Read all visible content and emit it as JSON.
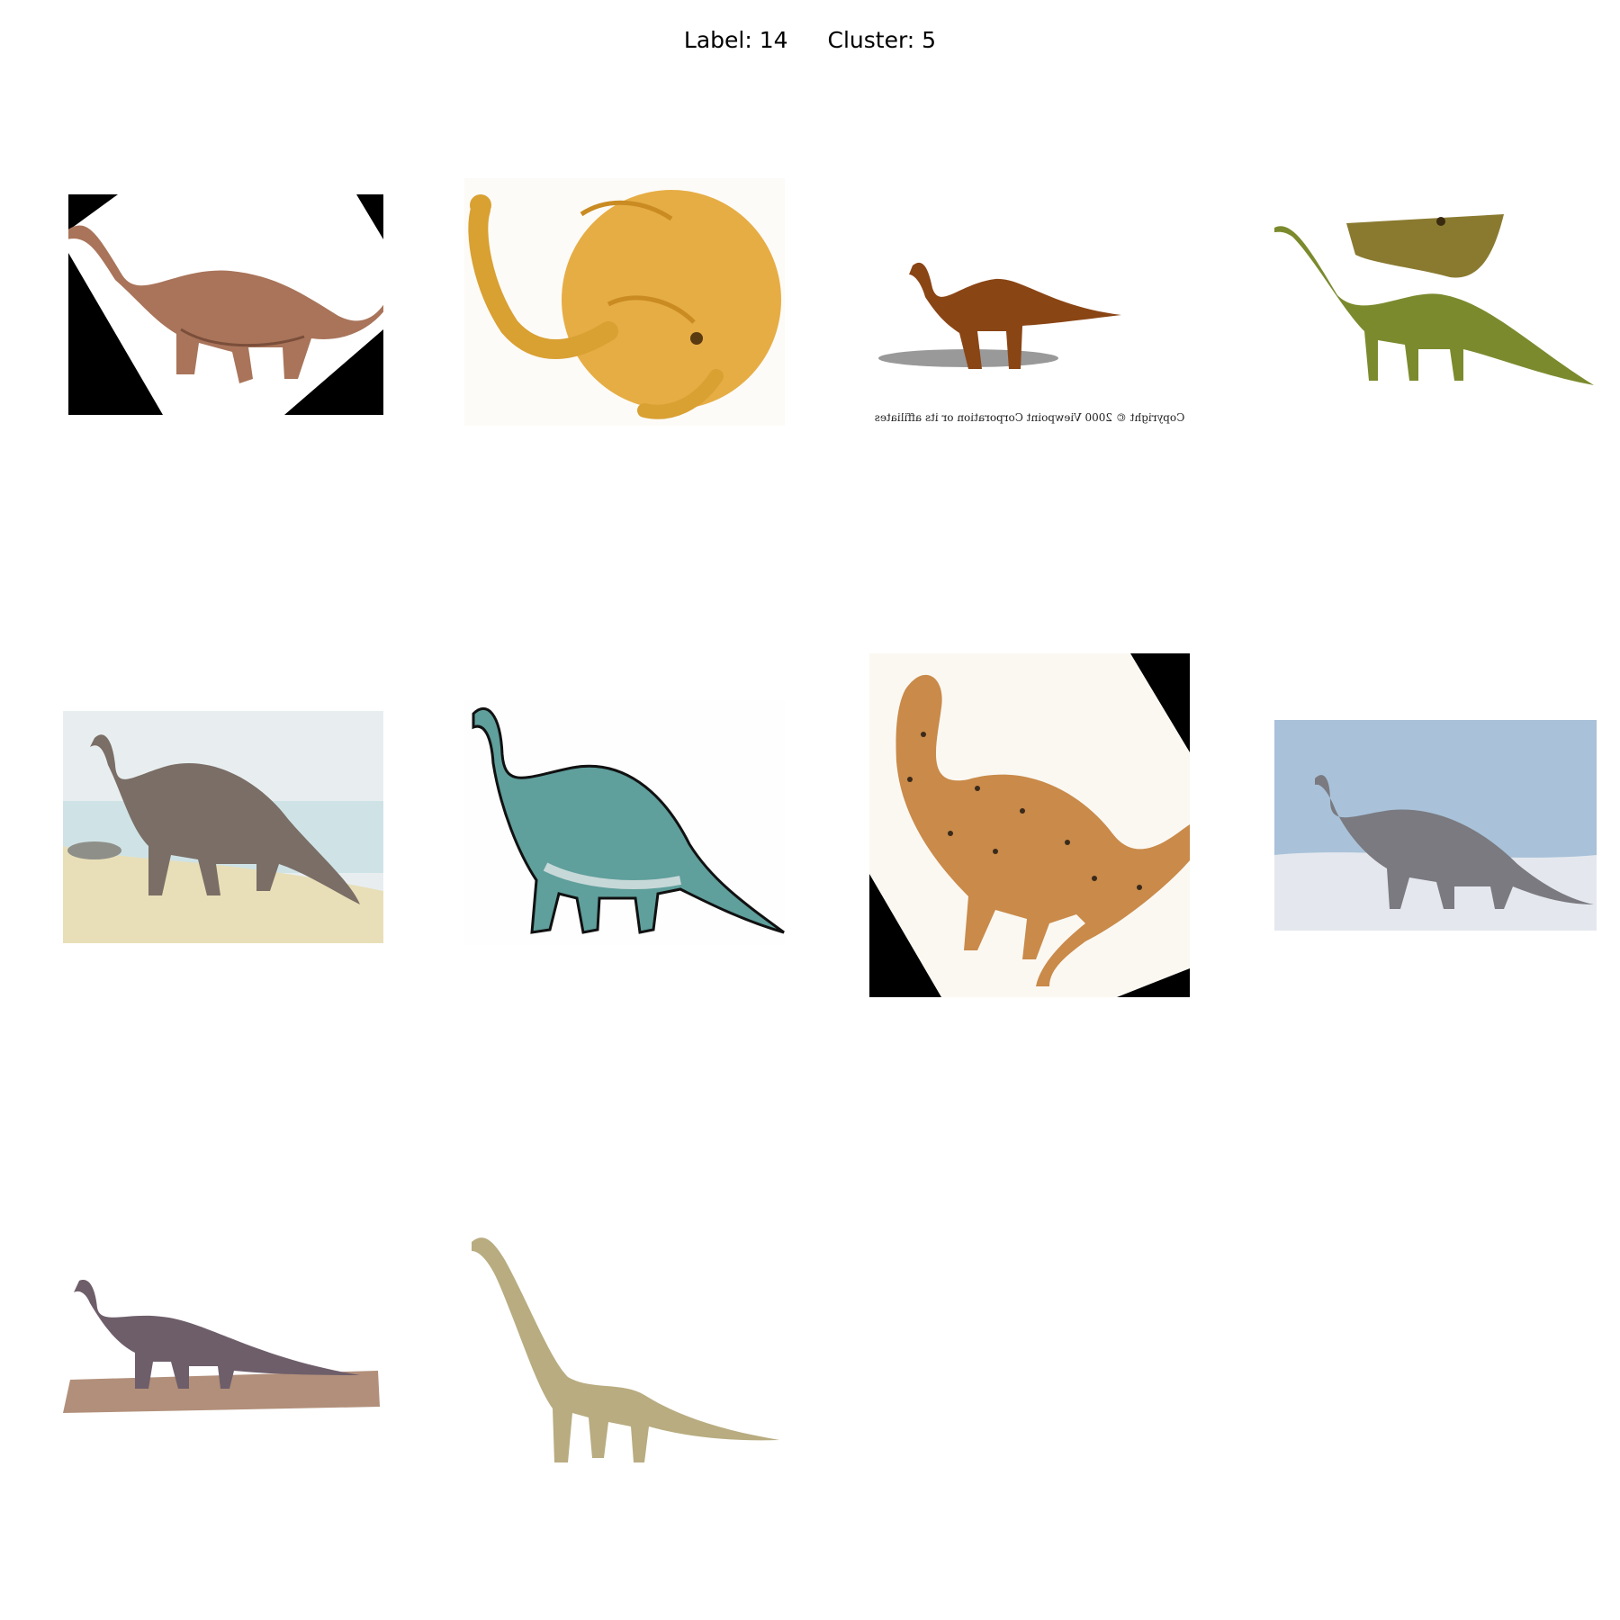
{
  "header": {
    "label_text": "Label: 14",
    "cluster_text": "Cluster: 5"
  },
  "images": [
    {
      "id": "dino-1",
      "desc": "brown sauropod, rotated with black corners",
      "colors": {
        "body": "#a9745a",
        "belly": "#c99a80"
      }
    },
    {
      "id": "dino-2",
      "desc": "yellow curled sauropod clipart",
      "colors": {
        "body": "#e6ad45",
        "shade": "#c98b22"
      }
    },
    {
      "id": "dino-3",
      "desc": "brown 3D sauropod with shadow",
      "colors": {
        "body": "#8a4515",
        "shadow": "#999999"
      },
      "caption": "Copyright © 2000 Viewpoint Corporation or its affiliates"
    },
    {
      "id": "dino-4",
      "desc": "green sauropod with head inset",
      "colors": {
        "body": "#7c8a2e",
        "head": "#8a7a30"
      }
    },
    {
      "id": "dino-5",
      "desc": "gray sauropod painting by water",
      "colors": {
        "body": "#7a6e66",
        "water": "#cfe3e6",
        "sand": "#e8dfb8"
      }
    },
    {
      "id": "dino-6",
      "desc": "teal cartoon sauropod",
      "colors": {
        "body": "#5f9f9c",
        "belly": "#c7d8d8"
      }
    },
    {
      "id": "dino-7",
      "desc": "speckled orange sauropod, rotated",
      "colors": {
        "body": "#c98a4a",
        "spots": "#3a2a1a"
      }
    },
    {
      "id": "dino-8",
      "desc": "gray sauropod in snowy landscape",
      "colors": {
        "body": "#7a7a80",
        "sky": "#a9c2d9",
        "ground": "#e4e8ee"
      }
    },
    {
      "id": "dino-9",
      "desc": "purple sauropod model on base",
      "colors": {
        "body": "#6e5e6a",
        "base": "#b28f7a"
      }
    },
    {
      "id": "dino-10",
      "desc": "tan brachiosaur model",
      "colors": {
        "body": "#b8ac80"
      }
    }
  ]
}
